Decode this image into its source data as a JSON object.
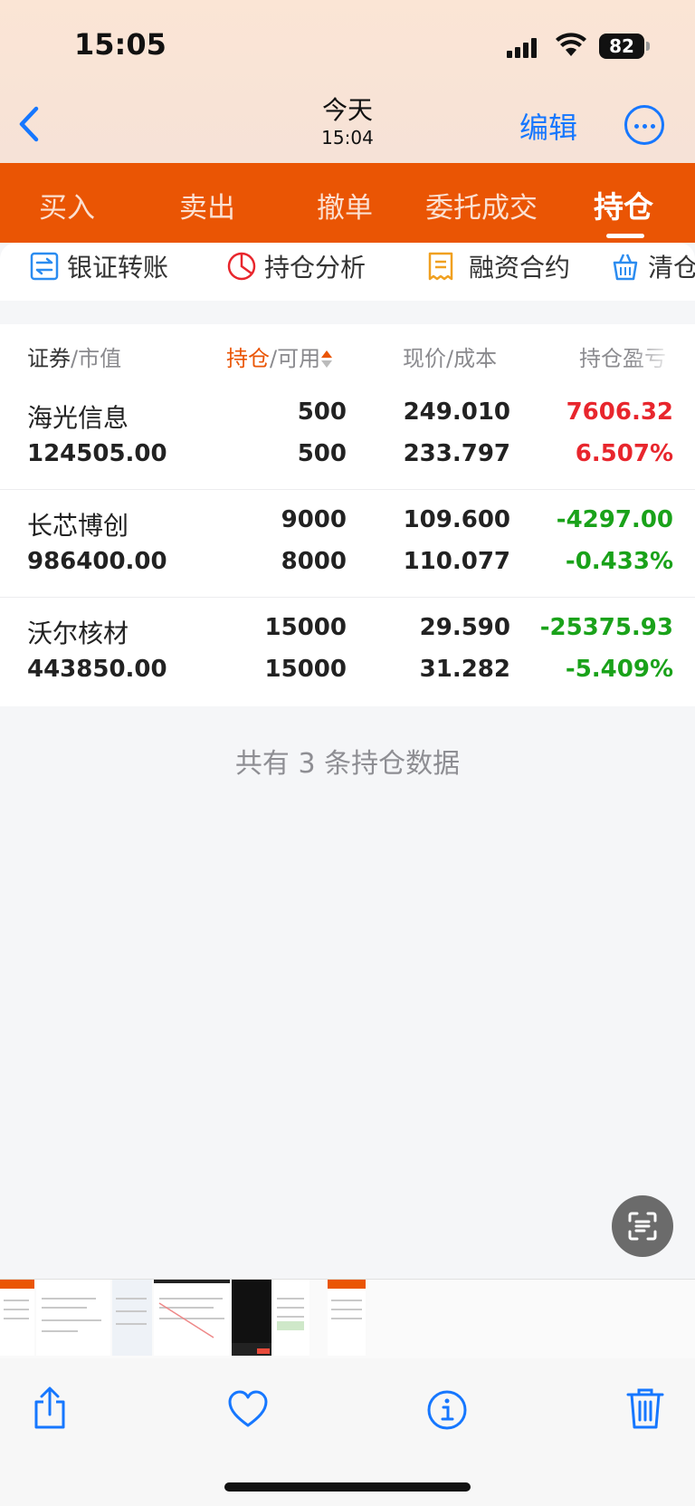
{
  "status_bar": {
    "time": "15:05",
    "battery": "82"
  },
  "nav": {
    "title": "今天",
    "subtitle": "15:04",
    "edit_label": "编辑"
  },
  "tabs": [
    {
      "label": "买入"
    },
    {
      "label": "卖出"
    },
    {
      "label": "撤单"
    },
    {
      "label": "委托成交"
    },
    {
      "label": "持仓",
      "active": true
    }
  ],
  "quick_actions": [
    {
      "label": "银证转账",
      "icon": "transfer-icon"
    },
    {
      "label": "持仓分析",
      "icon": "pie-chart-icon"
    },
    {
      "label": "融资合约",
      "icon": "contract-icon"
    },
    {
      "label": "清仓",
      "icon": "basket-icon"
    }
  ],
  "table": {
    "headers": {
      "security": "证券",
      "market_value": "市值",
      "position": "持仓",
      "available": "可用",
      "price": "现价",
      "cost": "成本",
      "pl": "持仓盈亏"
    },
    "rows": [
      {
        "name": "海光信息",
        "market_value": "124505.00",
        "position": "500",
        "available": "500",
        "price": "249.010",
        "cost": "233.797",
        "pl": "7606.32",
        "pl_pct": "6.507%",
        "status": "up"
      },
      {
        "name": "长芯博创",
        "market_value": "986400.00",
        "position": "9000",
        "available": "8000",
        "price": "109.600",
        "cost": "110.077",
        "pl": "-4297.00",
        "pl_pct": "-0.433%",
        "status": "down"
      },
      {
        "name": "沃尔核材",
        "market_value": "443850.00",
        "position": "15000",
        "available": "15000",
        "price": "29.590",
        "cost": "31.282",
        "pl": "-25375.93",
        "pl_pct": "-5.409%",
        "status": "down"
      }
    ],
    "summary": "共有 3 条持仓数据"
  },
  "colors": {
    "accent": "#ea5504",
    "link": "#1677ff",
    "up": "#e8262d",
    "down": "#1aa21a"
  },
  "bottom_bar": [
    "share-icon",
    "heart-icon",
    "info-icon",
    "trash-icon"
  ]
}
